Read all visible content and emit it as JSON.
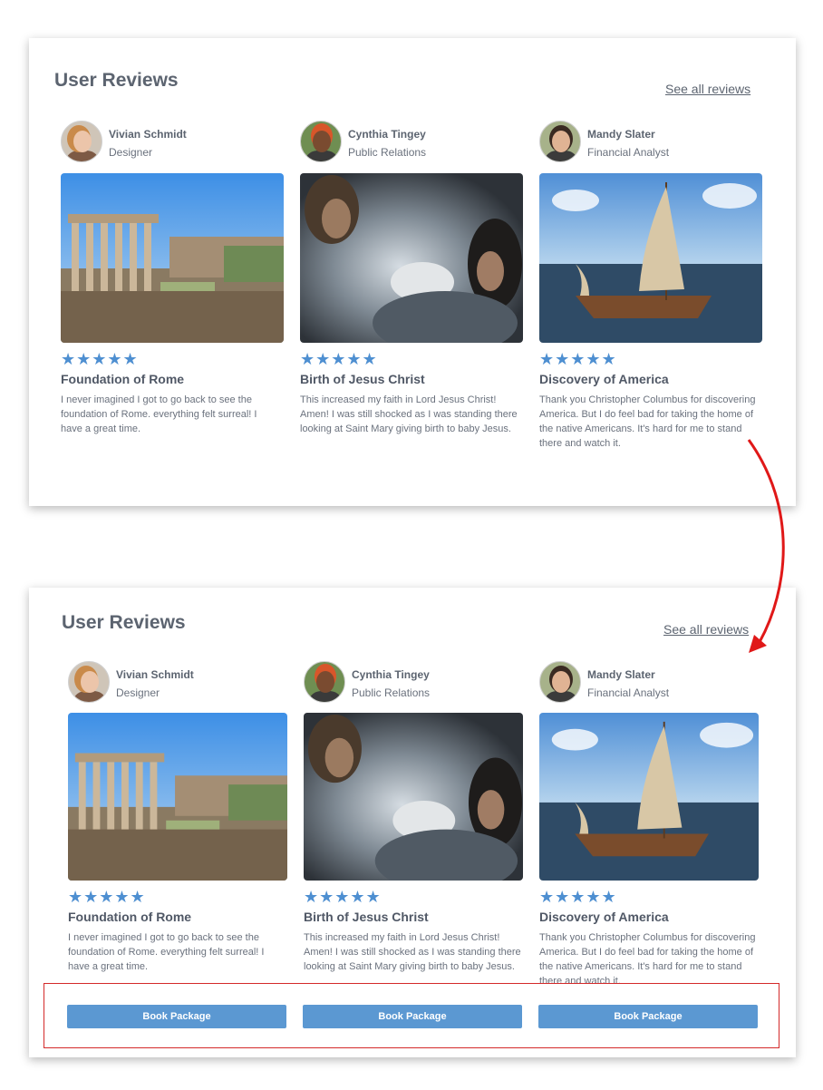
{
  "heading": "User Reviews",
  "see_all": "See all reviews",
  "book_label": "Book Package",
  "star_glyphs": "★★★★★",
  "accent_color": "#4e8fd1",
  "button_color": "#5b98d2",
  "annotation_color": "#d42a2a",
  "reviews": [
    {
      "name": "Vivian Schmidt",
      "role": "Designer",
      "rating": 5,
      "title": "Foundation of Rome",
      "text": "I never imagined I got to go back to see the foundation of Rome. everything felt surreal! I have a great time."
    },
    {
      "name": "Cynthia Tingey",
      "role": "Public Relations",
      "rating": 5,
      "title": "Birth of Jesus Christ",
      "text": "This increased my faith in Lord Jesus Christ! Amen! I was still shocked as I was standing there looking at Saint Mary giving birth to baby Jesus."
    },
    {
      "name": "Mandy Slater",
      "role": "Financial Analyst",
      "rating": 5,
      "title": "Discovery of America",
      "text": "Thank you Christopher Columbus for discovering America. But I do feel bad for taking the home of the native Americans. It's hard for me to stand there and watch it."
    }
  ]
}
